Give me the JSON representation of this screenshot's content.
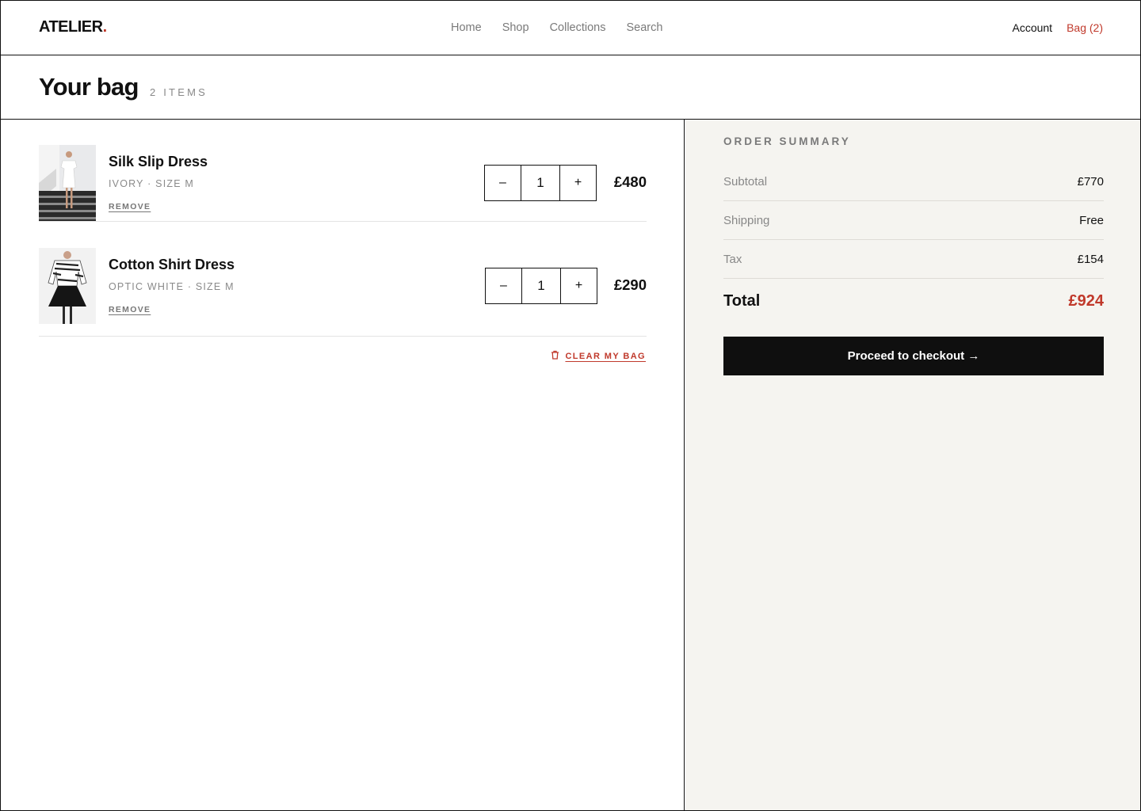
{
  "header": {
    "logo": "ATELIER",
    "logo_dot": ".",
    "nav": [
      "Home",
      "Shop",
      "Collections",
      "Search"
    ],
    "account": "Account",
    "bag": "Bag (2)"
  },
  "page": {
    "title": "Your bag",
    "count": "2 ITEMS"
  },
  "cart": {
    "items": [
      {
        "name": "Silk Slip Dress",
        "variant": "IVORY · SIZE M",
        "remove": "REMOVE",
        "minus": "–",
        "qty": "1",
        "plus": "+",
        "price": "£480"
      },
      {
        "name": "Cotton Shirt Dress",
        "variant": "OPTIC WHITE · SIZE M",
        "remove": "REMOVE",
        "minus": "–",
        "qty": "1",
        "plus": "+",
        "price": "£290"
      }
    ],
    "clear": "CLEAR MY BAG"
  },
  "summary": {
    "title": "ORDER SUMMARY",
    "rows": [
      {
        "label": "Subtotal",
        "value": "£770"
      },
      {
        "label": "Shipping",
        "value": "Free"
      },
      {
        "label": "Tax",
        "value": "£154"
      }
    ],
    "total_label": "Total",
    "total_value": "£924",
    "checkout": "Proceed to checkout →"
  },
  "colors": {
    "accent": "#c0392b",
    "panel": "#f5f4f0",
    "button": "#0f0f0f"
  },
  "icons": {
    "clear": "trash-icon"
  }
}
